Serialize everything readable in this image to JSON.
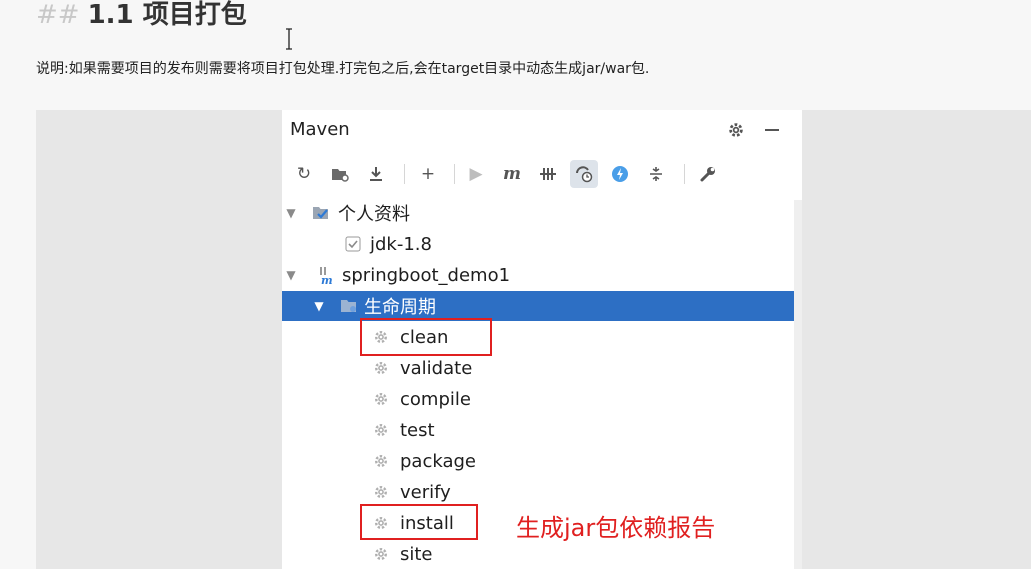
{
  "doc": {
    "heading_hash": "##",
    "heading": "1.1 项目打包",
    "description": "说明:如果需要项目的发布则需要将项目打包处理.打完包之后,会在target目录中动态生成jar/war包."
  },
  "maven": {
    "title": "Maven",
    "header_icons": [
      "gear-icon",
      "minimize-icon"
    ],
    "toolbar": [
      {
        "name": "reload-icon"
      },
      {
        "name": "add-folder-icon"
      },
      {
        "name": "download-icon"
      },
      {
        "name": "add-icon"
      },
      {
        "name": "run-icon"
      },
      {
        "name": "maven-goal-icon"
      },
      {
        "name": "skip-tests-icon"
      },
      {
        "name": "offline-icon"
      },
      {
        "name": "lightning-icon"
      },
      {
        "name": "collapse-icon"
      },
      {
        "name": "wrench-icon"
      }
    ],
    "tree": {
      "profiles": {
        "label": "个人资料"
      },
      "jdk": {
        "label": "jdk-1.8",
        "checked": true
      },
      "project": {
        "label": "springboot_demo1"
      },
      "lifecycle": {
        "label": "生命周期"
      },
      "phases": [
        "clean",
        "validate",
        "compile",
        "test",
        "package",
        "verify",
        "install",
        "site"
      ]
    },
    "highlighted": [
      "clean",
      "install"
    ],
    "annotation": "生成jar包依赖报告"
  },
  "colors": {
    "selection": "#2d6fc4",
    "annotation": "#e02020",
    "highlight_box": "#e02020"
  }
}
